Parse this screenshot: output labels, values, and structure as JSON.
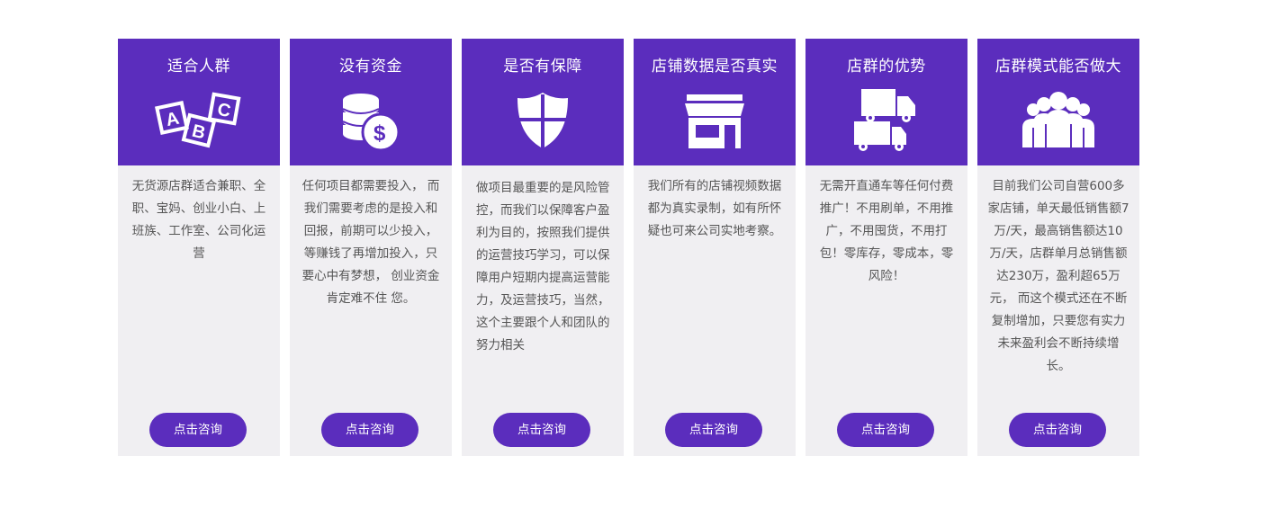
{
  "accent_color": "#5b2dbd",
  "cards": [
    {
      "title": "适合人群",
      "icon": "abc-blocks-icon",
      "text": "无货源店群适合兼职、全职、宝妈、创业小白、上班族、工作室、公司化运营",
      "button": "点击咨询"
    },
    {
      "title": "没有资金",
      "icon": "coins-dollar-icon",
      "text": "任何项目都需要投入， 而我们需要考虑的是投入和回报，前期可以少投入，等赚钱了再增加投入，只要心中有梦想， 创业资金肯定难不住 您。",
      "button": "点击咨询"
    },
    {
      "title": "是否有保障",
      "icon": "shield-icon",
      "text": "做项目最重要的是风险管控，而我们以保障客户盈利为目的，按照我们提供的运营技巧学习，可以保障用户短期内提高运营能力，及运营技巧，当然，这个主要跟个人和团队的努力相关",
      "button": "点击咨询"
    },
    {
      "title": "店铺数据是否真实",
      "icon": "storefront-icon",
      "text": "我们所有的店铺视频数据都为真实录制，如有所怀疑也可来公司实地考察。",
      "button": "点击咨询"
    },
    {
      "title": "店群的优势",
      "icon": "trucks-icon",
      "text": "无需开直通车等任何付费推广！不用刷单，不用推广，不用囤货，不用打包！零库存，零成本，零风险！",
      "button": "点击咨询"
    },
    {
      "title": "店群模式能否做大",
      "icon": "team-icon",
      "text": "目前我们公司自营600多家店铺，单天最低销售额7万/天，最高销售额达10万/天，店群单月总销售额达230万，盈利超65万元， 而这个模式还在不断复制增加，只要您有实力未来盈利会不断持续增长。",
      "button": "点击咨询"
    }
  ]
}
